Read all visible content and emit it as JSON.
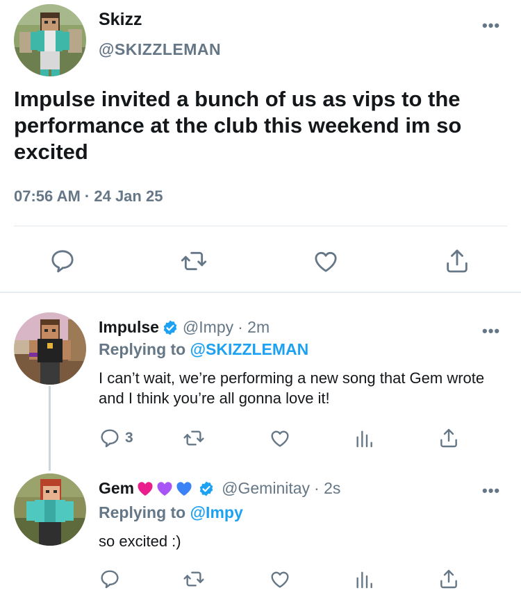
{
  "main_tweet": {
    "name": "Skizz",
    "handle": "@SKIZZLEMAN",
    "text": "Impulse invited a bunch of us as vips to the performance at the club this weekend im so excited",
    "time": "07:56 AM",
    "separator": "·",
    "date": "24 Jan 25",
    "more": "•••"
  },
  "replies": [
    {
      "name": "Impulse",
      "handle": "@Impy",
      "age": "· 2m",
      "replying_prefix": "Replying to ",
      "replying_to": "@SKIZZLEMAN",
      "text": "I can’t wait, we’re performing a new song that Gem wrote and I think you’re all gonna love it!",
      "reply_count": "3",
      "more": "•••"
    },
    {
      "name": "Gem",
      "handle": "@Geminitay",
      "age": "· 2s",
      "replying_prefix": "Replying to ",
      "replying_to": "@Impy",
      "text": "so excited :)",
      "more": "•••"
    }
  ],
  "icons": {
    "reply": "reply-icon",
    "retweet": "retweet-icon",
    "like": "like-icon",
    "share": "share-icon",
    "analytics": "analytics-icon",
    "verified": "verified-badge-icon"
  },
  "colors": {
    "accent": "#1da1f2",
    "secondary_text": "#657786",
    "divider": "#e1e8ed",
    "heart_pink": "#e91e8c",
    "heart_purple": "#a855f7",
    "heart_blue": "#3b82f6"
  }
}
